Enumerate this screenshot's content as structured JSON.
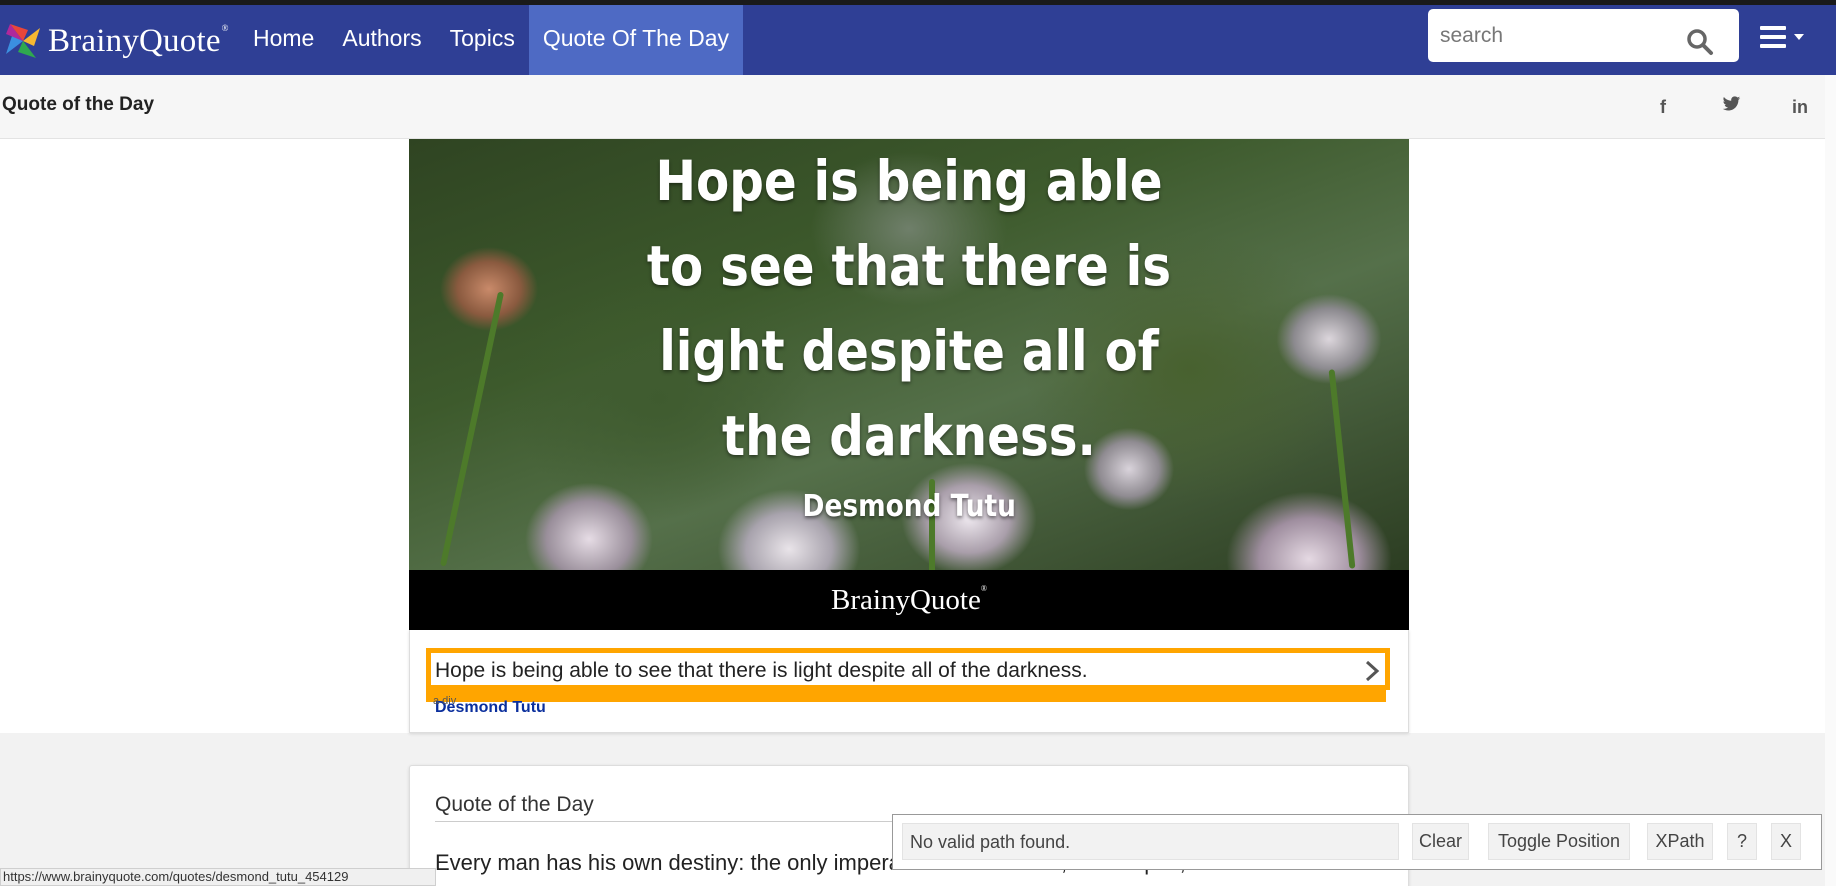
{
  "colors": {
    "nav_bg": "#2f3f95",
    "nav_active": "#4e6ac4",
    "highlight": "#ffa500",
    "author_link": "#0b2f9d"
  },
  "header": {
    "logo_text": "BrainyQuote",
    "logo_reg": "®",
    "nav": [
      {
        "label": "Home"
      },
      {
        "label": "Authors"
      },
      {
        "label": "Topics"
      },
      {
        "label": "Quote Of The Day",
        "active": true
      }
    ],
    "search": {
      "placeholder": "search",
      "value": ""
    },
    "icons": {
      "search": "search-icon",
      "menu": "hamburger-menu-icon"
    }
  },
  "subbar": {
    "title": "Quote of the Day",
    "social": [
      {
        "label": "f",
        "icon": "facebook-icon"
      },
      {
        "label": "🐦",
        "icon": "twitter-icon"
      },
      {
        "label": "in",
        "icon": "linkedin-icon"
      }
    ]
  },
  "featured": {
    "image_lines": [
      "Hope is being able",
      "to see that there is",
      "light despite all of",
      "the darkness."
    ],
    "image_author": "Desmond Tutu",
    "brand": "BrainyQuote",
    "brand_reg": "®",
    "quote": "Hope is being able to see that there is light despite all of the darkness.",
    "overlay_label": "a div",
    "author": "Desmond Tutu"
  },
  "qotd": {
    "title": "Quote of the Day",
    "text": "Every man has his own destiny: the only imperative is to follow it, to accept it, no matter"
  },
  "xpath_panel": {
    "message": "No valid path found.",
    "buttons": [
      "Clear",
      "Toggle Position",
      "XPath",
      "?",
      "X"
    ]
  },
  "status_url": "https://www.brainyquote.com/quotes/desmond_tutu_454129"
}
